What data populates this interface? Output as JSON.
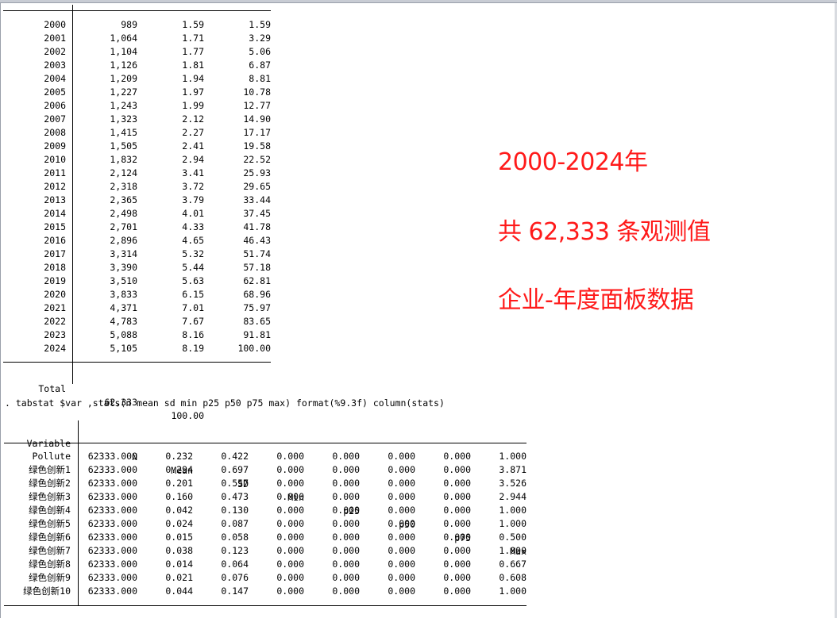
{
  "freq_table": {
    "rows": [
      {
        "year": "2000",
        "freq": "989",
        "percent": "1.59",
        "cum": "1.59"
      },
      {
        "year": "2001",
        "freq": "1,064",
        "percent": "1.71",
        "cum": "3.29"
      },
      {
        "year": "2002",
        "freq": "1,104",
        "percent": "1.77",
        "cum": "5.06"
      },
      {
        "year": "2003",
        "freq": "1,126",
        "percent": "1.81",
        "cum": "6.87"
      },
      {
        "year": "2004",
        "freq": "1,209",
        "percent": "1.94",
        "cum": "8.81"
      },
      {
        "year": "2005",
        "freq": "1,227",
        "percent": "1.97",
        "cum": "10.78"
      },
      {
        "year": "2006",
        "freq": "1,243",
        "percent": "1.99",
        "cum": "12.77"
      },
      {
        "year": "2007",
        "freq": "1,323",
        "percent": "2.12",
        "cum": "14.90"
      },
      {
        "year": "2008",
        "freq": "1,415",
        "percent": "2.27",
        "cum": "17.17"
      },
      {
        "year": "2009",
        "freq": "1,505",
        "percent": "2.41",
        "cum": "19.58"
      },
      {
        "year": "2010",
        "freq": "1,832",
        "percent": "2.94",
        "cum": "22.52"
      },
      {
        "year": "2011",
        "freq": "2,124",
        "percent": "3.41",
        "cum": "25.93"
      },
      {
        "year": "2012",
        "freq": "2,318",
        "percent": "3.72",
        "cum": "29.65"
      },
      {
        "year": "2013",
        "freq": "2,365",
        "percent": "3.79",
        "cum": "33.44"
      },
      {
        "year": "2014",
        "freq": "2,498",
        "percent": "4.01",
        "cum": "37.45"
      },
      {
        "year": "2015",
        "freq": "2,701",
        "percent": "4.33",
        "cum": "41.78"
      },
      {
        "year": "2016",
        "freq": "2,896",
        "percent": "4.65",
        "cum": "46.43"
      },
      {
        "year": "2017",
        "freq": "3,314",
        "percent": "5.32",
        "cum": "51.74"
      },
      {
        "year": "2018",
        "freq": "3,390",
        "percent": "5.44",
        "cum": "57.18"
      },
      {
        "year": "2019",
        "freq": "3,510",
        "percent": "5.63",
        "cum": "62.81"
      },
      {
        "year": "2020",
        "freq": "3,833",
        "percent": "6.15",
        "cum": "68.96"
      },
      {
        "year": "2021",
        "freq": "4,371",
        "percent": "7.01",
        "cum": "75.97"
      },
      {
        "year": "2022",
        "freq": "4,783",
        "percent": "7.67",
        "cum": "83.65"
      },
      {
        "year": "2023",
        "freq": "5,088",
        "percent": "8.16",
        "cum": "91.81"
      },
      {
        "year": "2024",
        "freq": "5,105",
        "percent": "8.19",
        "cum": "100.00"
      }
    ],
    "total": {
      "label": "Total",
      "freq": "62,333",
      "percent": "100.00"
    }
  },
  "command": ". tabstat $var ,stats(n mean sd min p25 p50 p75 max) format(%9.3f) column(stats)",
  "summary_table": {
    "headers": {
      "variable": "Variable",
      "n": "N",
      "mean": "Mean",
      "sd": "SD",
      "min": "Min",
      "p25": "p25",
      "p50": "p50",
      "p75": "p75",
      "max": "Max"
    },
    "rows": [
      {
        "variable": "Pollute",
        "n": "62333.000",
        "mean": "0.232",
        "sd": "0.422",
        "min": "0.000",
        "p25": "0.000",
        "p50": "0.000",
        "p75": "0.000",
        "max": "1.000"
      },
      {
        "variable": "绿色创新1",
        "n": "62333.000",
        "mean": "0.294",
        "sd": "0.697",
        "min": "0.000",
        "p25": "0.000",
        "p50": "0.000",
        "p75": "0.000",
        "max": "3.871"
      },
      {
        "variable": "绿色创新2",
        "n": "62333.000",
        "mean": "0.201",
        "sd": "0.557",
        "min": "0.000",
        "p25": "0.000",
        "p50": "0.000",
        "p75": "0.000",
        "max": "3.526"
      },
      {
        "variable": "绿色创新3",
        "n": "62333.000",
        "mean": "0.160",
        "sd": "0.473",
        "min": "0.000",
        "p25": "0.000",
        "p50": "0.000",
        "p75": "0.000",
        "max": "2.944"
      },
      {
        "variable": "绿色创新4",
        "n": "62333.000",
        "mean": "0.042",
        "sd": "0.130",
        "min": "0.000",
        "p25": "0.000",
        "p50": "0.000",
        "p75": "0.000",
        "max": "1.000"
      },
      {
        "variable": "绿色创新5",
        "n": "62333.000",
        "mean": "0.024",
        "sd": "0.087",
        "min": "0.000",
        "p25": "0.000",
        "p50": "0.000",
        "p75": "0.000",
        "max": "1.000"
      },
      {
        "variable": "绿色创新6",
        "n": "62333.000",
        "mean": "0.015",
        "sd": "0.058",
        "min": "0.000",
        "p25": "0.000",
        "p50": "0.000",
        "p75": "0.000",
        "max": "0.500"
      },
      {
        "variable": "绿色创新7",
        "n": "62333.000",
        "mean": "0.038",
        "sd": "0.123",
        "min": "0.000",
        "p25": "0.000",
        "p50": "0.000",
        "p75": "0.000",
        "max": "1.000"
      },
      {
        "variable": "绿色创新8",
        "n": "62333.000",
        "mean": "0.014",
        "sd": "0.064",
        "min": "0.000",
        "p25": "0.000",
        "p50": "0.000",
        "p75": "0.000",
        "max": "0.667"
      },
      {
        "variable": "绿色创新9",
        "n": "62333.000",
        "mean": "0.021",
        "sd": "0.076",
        "min": "0.000",
        "p25": "0.000",
        "p50": "0.000",
        "p75": "0.000",
        "max": "0.608"
      },
      {
        "variable": "绿色创新10",
        "n": "62333.000",
        "mean": "0.044",
        "sd": "0.147",
        "min": "0.000",
        "p25": "0.000",
        "p50": "0.000",
        "p75": "0.000",
        "max": "1.000"
      }
    ]
  },
  "annotations": {
    "line1": "2000-2024年",
    "line2": "共 62,333 条观测值",
    "line3": "企业-年度面板数据"
  },
  "colors": {
    "annotation": "#ff1a1a",
    "background": "#ffffff",
    "text": "#000000"
  }
}
